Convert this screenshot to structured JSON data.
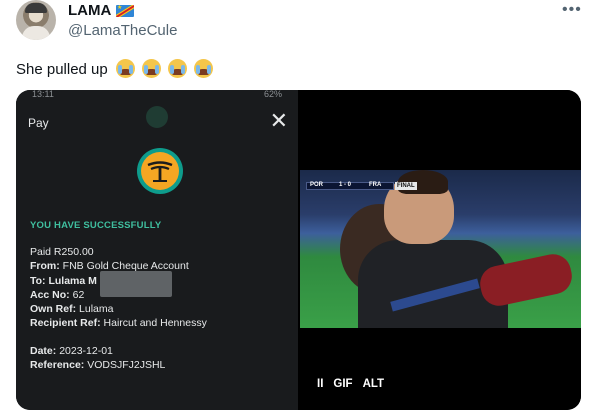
{
  "tweet": {
    "author_name": "LAMA",
    "author_handle": "@LamaTheCule",
    "text": "She pulled up",
    "emoji": [
      "loudly-crying-face",
      "loudly-crying-face",
      "loudly-crying-face",
      "loudly-crying-face"
    ],
    "more_label": "•••"
  },
  "media_left": {
    "status_time": "13:11",
    "status_right": "62%",
    "title": "Pay",
    "close_label": "✕",
    "success_text": "YOU HAVE SUCCESSFULLY",
    "paid": "Paid R250.00",
    "from_label": "From:",
    "from_value": "FNB Gold Cheque Account",
    "to_label": "To:",
    "to_value": "Lulama M",
    "acc_label": "Acc No:",
    "acc_value": "62",
    "own_ref_label": "Own Ref:",
    "own_ref_value": "Lulama",
    "recipient_ref_label": "Recipient Ref:",
    "recipient_ref_value": "Haircut and Hennessy",
    "date_label": "Date:",
    "date_value": "2023-12-01",
    "reference_label": "Reference:",
    "reference_value": "VODSJFJ2JSHL"
  },
  "media_right": {
    "score_home": "POR",
    "score": "1 - 0",
    "score_away": "FRA",
    "final_label": "FINAL",
    "pause_label": "II",
    "gif_label": "GIF",
    "alt_label": "ALT"
  },
  "colors": {
    "success_green": "#3fbf9f",
    "fnb_teal": "#0e9c8c",
    "fnb_orange": "#f5a623",
    "handle_gray": "#536471"
  }
}
